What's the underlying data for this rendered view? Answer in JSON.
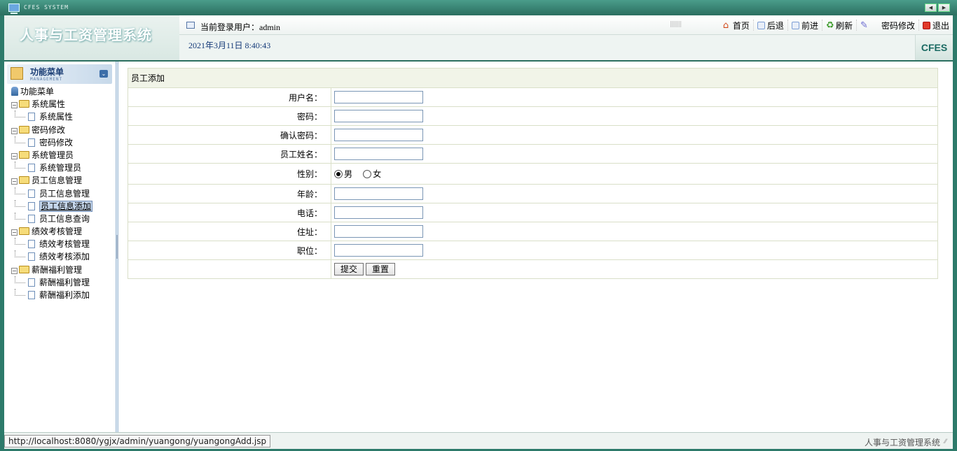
{
  "titlebar": {
    "system_label": "CFES SYSTEM",
    "nav_prev": "◀",
    "nav_next": "▶"
  },
  "header": {
    "app_title": "人事与工资管理系统",
    "current_user": "当前登录用户：admin",
    "datetime": "2021年3月11日 8:40:43",
    "badge": "CFES",
    "toolbar": [
      {
        "label": "首页",
        "icon": "home-icon"
      },
      {
        "label": "后退",
        "icon": "back-icon"
      },
      {
        "label": "前进",
        "icon": "forward-icon"
      },
      {
        "label": "刷新",
        "icon": "refresh-icon"
      },
      {
        "label": "密码修改",
        "icon": "password-icon"
      },
      {
        "label": "退出",
        "icon": "exit-icon"
      }
    ]
  },
  "sidebar": {
    "head_title": "功能菜单",
    "head_sub": "MANAGEMENT",
    "root_label": "功能菜单",
    "groups": [
      {
        "label": "系统属性",
        "items": [
          "系统属性"
        ]
      },
      {
        "label": "密码修改",
        "items": [
          "密码修改"
        ]
      },
      {
        "label": "系统管理员",
        "items": [
          "系统管理员"
        ]
      },
      {
        "label": "员工信息管理",
        "items": [
          "员工信息管理",
          "员工信息添加",
          "员工信息查询"
        ]
      },
      {
        "label": "绩效考核管理",
        "items": [
          "绩效考核管理",
          "绩效考核添加"
        ]
      },
      {
        "label": "薪酬福利管理",
        "items": [
          "薪酬福利管理",
          "薪酬福利添加"
        ]
      }
    ],
    "selected": "员工信息添加"
  },
  "form": {
    "title": "员工添加",
    "fields": {
      "username": {
        "label": "用户名：",
        "value": ""
      },
      "password": {
        "label": "密码：",
        "value": ""
      },
      "confirm": {
        "label": "确认密码：",
        "value": ""
      },
      "name": {
        "label": "员工姓名：",
        "value": ""
      },
      "gender": {
        "label": "性别：",
        "male": "男",
        "female": "女",
        "selected": "男"
      },
      "age": {
        "label": "年龄：",
        "value": ""
      },
      "phone": {
        "label": "电话：",
        "value": ""
      },
      "address": {
        "label": "住址：",
        "value": ""
      },
      "position": {
        "label": "职位：",
        "value": ""
      }
    },
    "submit_label": "提交",
    "reset_label": "重置"
  },
  "status": {
    "url": "http://localhost:8080/ygjx/admin/yuangong/yuangongAdd.jsp",
    "right_text": "人事与工资管理系统"
  }
}
